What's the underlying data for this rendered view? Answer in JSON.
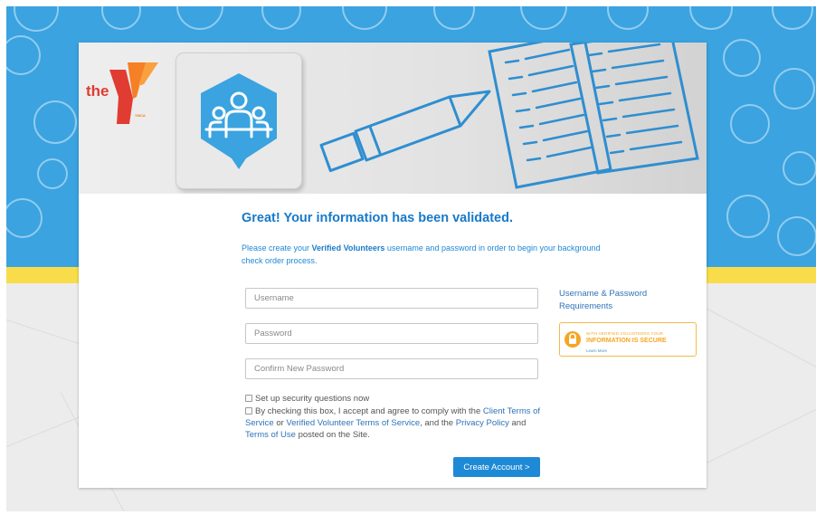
{
  "colors": {
    "accent_blue": "#1779c9",
    "button_blue": "#1e8ad6",
    "background_blue": "#3aa3e0",
    "background_yellow": "#f9dc4a",
    "secure_orange": "#f5a623",
    "ymca_red": "#e03c31",
    "ymca_orange": "#f58025"
  },
  "banner": {
    "logo_text": "the",
    "logo_mark_text": "YMCA",
    "logo_icon": "ymca-y-icon",
    "tile_icon": "volunteer-group-icon",
    "art_icon": "pencil-and-checklist-icon"
  },
  "form": {
    "heading": "Great! Your information has been validated.",
    "intro": {
      "before": "Please create your ",
      "brand": "Verified Volunteers",
      "after": " username and password in order to begin your background check order process."
    },
    "username_placeholder": "Username",
    "password_placeholder": "Password",
    "confirm_placeholder": "Confirm New Password",
    "security_questions_label": "Set up security questions now",
    "terms": {
      "part1": "By checking this box, I accept and agree to comply with the ",
      "link_client": "Client Terms of Service",
      "part2": " or ",
      "link_vv": "Verified Volunteer Terms of Service",
      "part3": ", and the ",
      "link_privacy": "Privacy Policy",
      "part4": " and ",
      "link_use": "Terms of Use",
      "part5": " posted on the Site."
    },
    "submit_label": "Create Account >"
  },
  "side": {
    "requirements_link": "Username & Password Requirements",
    "secure_badge": {
      "icon": "lock-icon",
      "line1": "WITH VERIFIED VOLUNTEERS YOUR",
      "line2_plain": "INFORMATION IS ",
      "line2_bold": "SECURE",
      "learn_more": "Learn More"
    }
  }
}
